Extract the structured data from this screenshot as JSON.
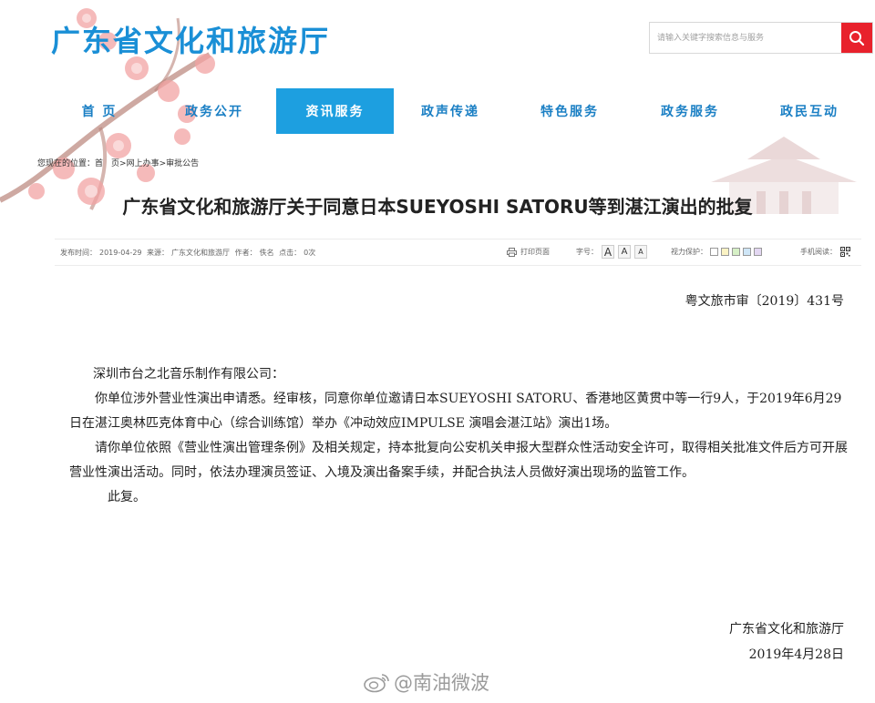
{
  "header": {
    "site_title": "广东省文化和旅游厅",
    "search_placeholder": "请输入关键字搜索信息与服务"
  },
  "nav": {
    "items": [
      {
        "label": "首 页"
      },
      {
        "label": "政务公开"
      },
      {
        "label": "资讯服务",
        "active": true
      },
      {
        "label": "政声传递"
      },
      {
        "label": "特色服务"
      },
      {
        "label": "政务服务"
      },
      {
        "label": "政民互动"
      }
    ]
  },
  "breadcrumb": {
    "prefix": "您现在的位置：",
    "home": "首　页",
    "sep1": ">",
    "section": "网上办事",
    "sep2": ">",
    "current": "审批公告"
  },
  "article": {
    "title": "广东省文化和旅游厅关于同意日本SUEYOSHI SATORU等到湛江演出的批复",
    "meta": {
      "publish_label": "发布时间：",
      "publish_date": "2019-04-29",
      "source_label": "来源：",
      "source": "广东文化和旅游厅",
      "author_label": "作者：",
      "author": "佚名",
      "clicks_label": "点击：",
      "clicks": "0次"
    },
    "tools": {
      "print": "打印页面",
      "font_label": "字号：",
      "font_sizes": [
        "A",
        "A",
        "A"
      ],
      "vision_label": "视力保护：",
      "mobile_label": "手机阅读："
    },
    "doc_number": "粤文旅市审〔2019〕431号",
    "salutation": "深圳市台之北音乐制作有限公司：",
    "para1": "你单位涉外营业性演出申请悉。经审核，同意你单位邀请日本SUEYOSHI SATORU、香港地区黄贯中等一行9人，于2019年6月29日在湛江奥林匹克体育中心（综合训练馆）举办《冲动效应IMPULSE 演唱会湛江站》演出1场。",
    "para2": "请你单位依照《营业性演出管理条例》及相关规定，持本批复向公安机关申报大型群众性活动安全许可，取得相关批准文件后方可开展营业性演出活动。同时，依法办理演员签证、入境及演出备案手续，并配合执法人员做好演出现场的监管工作。",
    "closing": "此复。",
    "signer": "广东省文化和旅游厅",
    "sign_date": "2019年4月28日"
  },
  "colors": {
    "brand_blue": "#1a8fd6",
    "nav_active_bg": "#1d9fe0",
    "search_btn": "#e8212c",
    "vision_swatches": [
      "#ffffff",
      "#fbf3c4",
      "#d6f0c6",
      "#cfe6f7",
      "#e3d7f2"
    ]
  },
  "icons": {
    "search": "search-icon",
    "print": "printer-icon",
    "mobile": "qr-code-icon",
    "watermark_logo": "weibo-icon"
  },
  "watermark": {
    "text": "@南油微波"
  }
}
